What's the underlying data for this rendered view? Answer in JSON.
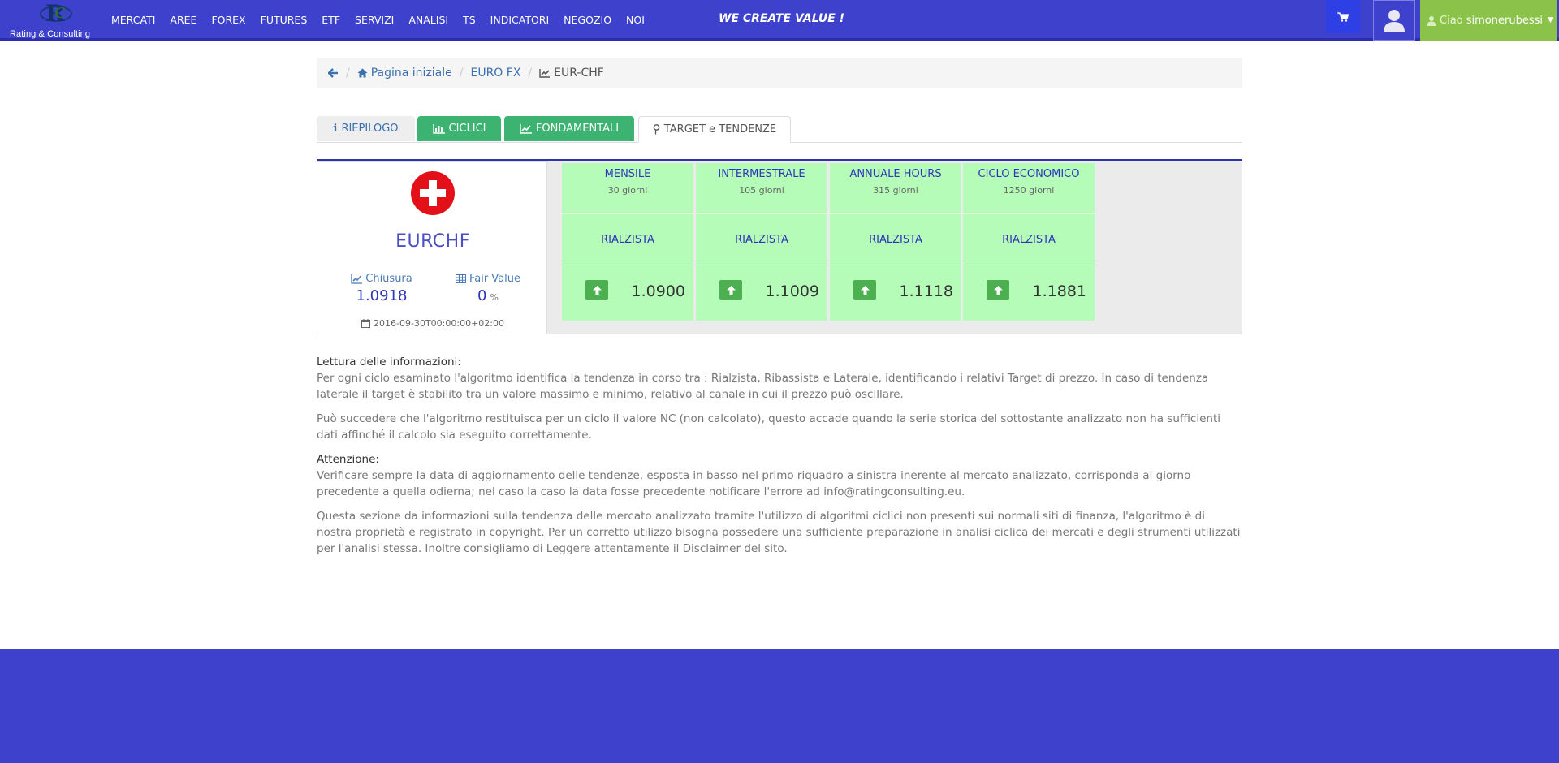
{
  "brand": {
    "logo_text": "Rating & Consulting"
  },
  "nav": {
    "items": [
      "MERCATI",
      "AREE",
      "FOREX",
      "FUTURES",
      "ETF",
      "SERVIZI",
      "ANALISI",
      "TS",
      "INDICATORI",
      "NEGOZIO",
      "NOI"
    ],
    "slogan": "WE CREATE VALUE !",
    "user_greeting": "Ciao",
    "username": "simonerubessi"
  },
  "breadcrumb": {
    "home": "Pagina iniziale",
    "category": "EURO FX",
    "current": "EUR-CHF"
  },
  "tabs": {
    "riepilogo": "RIEPILOGO",
    "ciclici": "CICLICI",
    "fondamentali": "FONDAMENTALI",
    "target": "TARGET e TENDENZE"
  },
  "asset": {
    "name": "EURCHF",
    "close_label": "Chiusura",
    "close_value": "1.0918",
    "fair_label": "Fair Value",
    "fair_value": "0",
    "fair_unit": "%",
    "date": "2016-09-30T00:00:00+02:00"
  },
  "cycles": [
    {
      "name": "MENSILE",
      "days": "30 giorni",
      "trend": "RIALZISTA",
      "target": "1.0900"
    },
    {
      "name": "INTERMESTRALE",
      "days": "105 giorni",
      "trend": "RIALZISTA",
      "target": "1.1009"
    },
    {
      "name": "ANNUALE HOURS",
      "days": "315 giorni",
      "trend": "RIALZISTA",
      "target": "1.1118"
    },
    {
      "name": "CICLO ECONOMICO",
      "days": "1250 giorni",
      "trend": "RIALZISTA",
      "target": "1.1881"
    }
  ],
  "info": {
    "title1": "Lettura delle informazioni:",
    "p1": "Per ogni ciclo esaminato l'algoritmo identifica la tendenza in corso tra : Rialzista, Ribassista e Laterale, identificando i relativi Target di prezzo. In caso di tendenza laterale il target è stabilito tra un valore massimo e minimo, relativo al canale in cui il prezzo può oscillare.",
    "p2": "Può succedere che l'algoritmo restituisca per un ciclo il valore NC (non calcolato), questo accade quando la serie storica del sottostante analizzato non ha sufficienti dati affinché il calcolo sia eseguito correttamente.",
    "title2": "Attenzione:",
    "p3": "Verificare sempre la data di aggiornamento delle tendenze, esposta in basso nel primo riquadro a sinistra inerente al mercato analizzato, corrisponda al giorno precedente a quella odierna; nel caso la caso la data fosse precedente notificare l'errore ad info@ratingconsulting.eu.",
    "p4": "Questa sezione da informazioni sulla tendenza delle mercato analizzato tramite l'utilizzo di algoritmi ciclici non presenti sui normali siti di finanza, l'algoritmo è di nostra proprietà e registrato in copyright. Per un corretto utilizzo bisogna possedere una sufficiente preparazione in analisi ciclica dei mercati e degli strumenti utilizzati per l'analisi stessa. Inoltre consigliamo di Leggere attentamente il Disclaimer del sito."
  },
  "colors": {
    "navbar": "#3d41cc",
    "user_button": "#8bc34a",
    "tab_green": "#3cb371",
    "cycle_bg": "#b5fcb8",
    "flag_red": "#e3101a"
  }
}
